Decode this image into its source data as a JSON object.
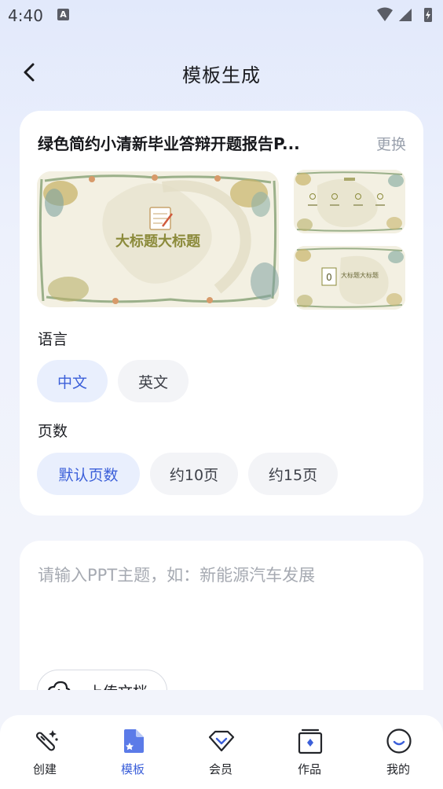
{
  "status_bar": {
    "time": "4:40",
    "notification_badge": "A"
  },
  "header": {
    "title": "模板生成"
  },
  "template_card": {
    "name": "绿色简约小清新毕业答辩开题报告P...",
    "change_label": "更换",
    "preview_title": "大标题大标题",
    "preview_small_title": "大标题大标题",
    "preview_small_number": "0"
  },
  "language": {
    "label": "语言",
    "options": [
      {
        "label": "中文",
        "selected": true
      },
      {
        "label": "英文",
        "selected": false
      }
    ]
  },
  "pages": {
    "label": "页数",
    "options": [
      {
        "label": "默认页数",
        "selected": true
      },
      {
        "label": "约10页",
        "selected": false
      },
      {
        "label": "约15页",
        "selected": false
      }
    ]
  },
  "topic_input": {
    "placeholder": "请输入PPT主题，如：新能源汽车发展",
    "value": "",
    "upload_label": "上传文档"
  },
  "tab_bar": {
    "tabs": [
      {
        "label": "创建",
        "icon": "magic-wand-icon",
        "active": false
      },
      {
        "label": "模板",
        "icon": "template-icon",
        "active": true
      },
      {
        "label": "会员",
        "icon": "diamond-icon",
        "active": false
      },
      {
        "label": "作品",
        "icon": "works-icon",
        "active": false
      },
      {
        "label": "我的",
        "icon": "smile-icon",
        "active": false
      }
    ]
  },
  "colors": {
    "accent": "#3b5fd9",
    "accent_bg": "#e9effd",
    "chip_bg": "#f3f4f7"
  }
}
